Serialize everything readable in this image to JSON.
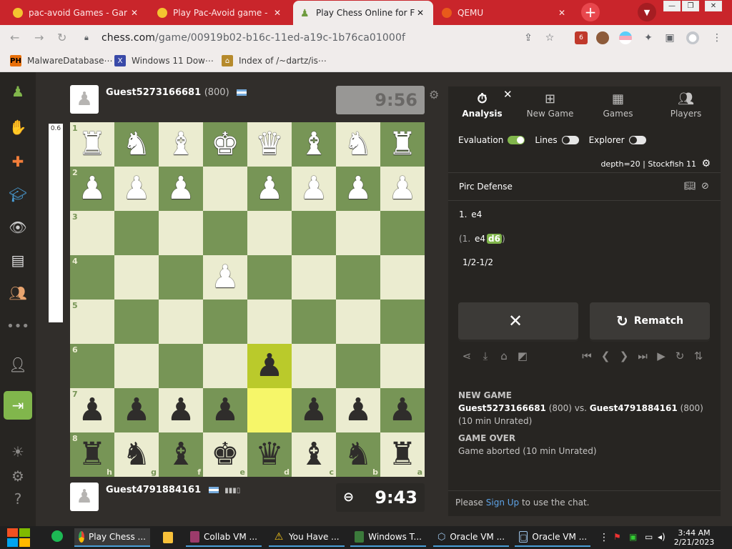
{
  "browser": {
    "tabs": [
      {
        "title": "pac-avoid Games - Gar",
        "icon": "pacman-icon",
        "active": false
      },
      {
        "title": "Play Pac-Avoid game -",
        "icon": "pacman-icon",
        "active": false
      },
      {
        "title": "Play Chess Online for Fr",
        "icon": "chess-pawn-icon",
        "active": true
      },
      {
        "title": "QEMU",
        "icon": "qemu-icon",
        "active": false
      }
    ],
    "url_host": "chess.com",
    "url_path": "/game/00919b02-b16c-11ed-a19c-1b76ca01000f",
    "extension_badge": "6"
  },
  "bookmarks": {
    "items": [
      {
        "label": "MalwareDatabase⋯",
        "icon": "ph-icon"
      },
      {
        "label": "Windows 11 Dow⋯",
        "icon": "x-icon"
      },
      {
        "label": "Index of /~dartz/is⋯",
        "icon": "archive-icon"
      }
    ]
  },
  "players": {
    "top": {
      "name": "Guest5273166681",
      "rating": "(800)",
      "clock": "9:56"
    },
    "bottom": {
      "name": "Guest4791884161",
      "rating": "",
      "clock": "9:43"
    }
  },
  "eval": {
    "value": "0.6",
    "white_fraction": 1.0
  },
  "board": {
    "ranks": [
      "1",
      "2",
      "3",
      "4",
      "5",
      "6",
      "7",
      "8"
    ],
    "files": [
      "h",
      "g",
      "f",
      "e",
      "d",
      "c",
      "b",
      "a"
    ],
    "pieces": [
      {
        "r": 0,
        "c": 0,
        "p": "♜",
        "w": true
      },
      {
        "r": 0,
        "c": 1,
        "p": "♞",
        "w": true
      },
      {
        "r": 0,
        "c": 2,
        "p": "♝",
        "w": true
      },
      {
        "r": 0,
        "c": 3,
        "p": "♚",
        "w": true
      },
      {
        "r": 0,
        "c": 4,
        "p": "♛",
        "w": true
      },
      {
        "r": 0,
        "c": 5,
        "p": "♝",
        "w": true
      },
      {
        "r": 0,
        "c": 6,
        "p": "♞",
        "w": true
      },
      {
        "r": 0,
        "c": 7,
        "p": "♜",
        "w": true
      },
      {
        "r": 1,
        "c": 0,
        "p": "♟",
        "w": true
      },
      {
        "r": 1,
        "c": 1,
        "p": "♟",
        "w": true
      },
      {
        "r": 1,
        "c": 2,
        "p": "♟",
        "w": true
      },
      {
        "r": 1,
        "c": 4,
        "p": "♟",
        "w": true
      },
      {
        "r": 1,
        "c": 5,
        "p": "♟",
        "w": true
      },
      {
        "r": 1,
        "c": 6,
        "p": "♟",
        "w": true
      },
      {
        "r": 1,
        "c": 7,
        "p": "♟",
        "w": true
      },
      {
        "r": 3,
        "c": 3,
        "p": "♟",
        "w": true
      },
      {
        "r": 5,
        "c": 4,
        "p": "♟",
        "w": false
      },
      {
        "r": 6,
        "c": 0,
        "p": "♟",
        "w": false
      },
      {
        "r": 6,
        "c": 1,
        "p": "♟",
        "w": false
      },
      {
        "r": 6,
        "c": 2,
        "p": "♟",
        "w": false
      },
      {
        "r": 6,
        "c": 3,
        "p": "♟",
        "w": false
      },
      {
        "r": 6,
        "c": 5,
        "p": "♟",
        "w": false
      },
      {
        "r": 6,
        "c": 6,
        "p": "♟",
        "w": false
      },
      {
        "r": 6,
        "c": 7,
        "p": "♟",
        "w": false
      },
      {
        "r": 7,
        "c": 0,
        "p": "♜",
        "w": false
      },
      {
        "r": 7,
        "c": 1,
        "p": "♞",
        "w": false
      },
      {
        "r": 7,
        "c": 2,
        "p": "♝",
        "w": false
      },
      {
        "r": 7,
        "c": 3,
        "p": "♚",
        "w": false
      },
      {
        "r": 7,
        "c": 4,
        "p": "♛",
        "w": false
      },
      {
        "r": 7,
        "c": 5,
        "p": "♝",
        "w": false
      },
      {
        "r": 7,
        "c": 6,
        "p": "♞",
        "w": false
      },
      {
        "r": 7,
        "c": 7,
        "p": "♜",
        "w": false
      }
    ],
    "highlights": [
      {
        "r": 5,
        "c": 4
      },
      {
        "r": 6,
        "c": 4
      }
    ],
    "colors": {
      "light": "#ebecd0",
      "dark": "#779556",
      "highlight": "#f6f669",
      "highlight_dark": "#baca2b"
    }
  },
  "panel": {
    "tabs": [
      "Analysis",
      "New Game",
      "Games",
      "Players"
    ],
    "toggles": [
      "Evaluation",
      "Lines",
      "Explorer"
    ],
    "engine": "depth=20 |  Stockfish 11",
    "opening": "Pirc Defense",
    "moves": {
      "line1_num": "1.",
      "line1_move": "e4",
      "line2_open": "(1.",
      "line2_move1": "e4",
      "line2_move2": "d6",
      "line2_close": ")",
      "result": "1/2-1/2"
    },
    "rematch": "Rematch",
    "log": {
      "h1": "NEW GAME",
      "p1": "Guest5273166681",
      "r1": " (800) vs. ",
      "p2": "Guest4791884161",
      "r2": " (800)",
      "mode": "(10 min Unrated)",
      "h2": "GAME OVER",
      "over": "Game aborted (10 min Unrated)"
    },
    "chat": {
      "pre": "Please ",
      "link": "Sign Up",
      "post": " to use the chat."
    }
  },
  "taskbar": {
    "items": [
      "Play Chess ...",
      "",
      "Collab VM ...",
      "You Have ...",
      "Windows T...",
      "Oracle VM ...",
      "Oracle VM ..."
    ],
    "time": "3:44 AM",
    "date": "2/21/2023"
  }
}
